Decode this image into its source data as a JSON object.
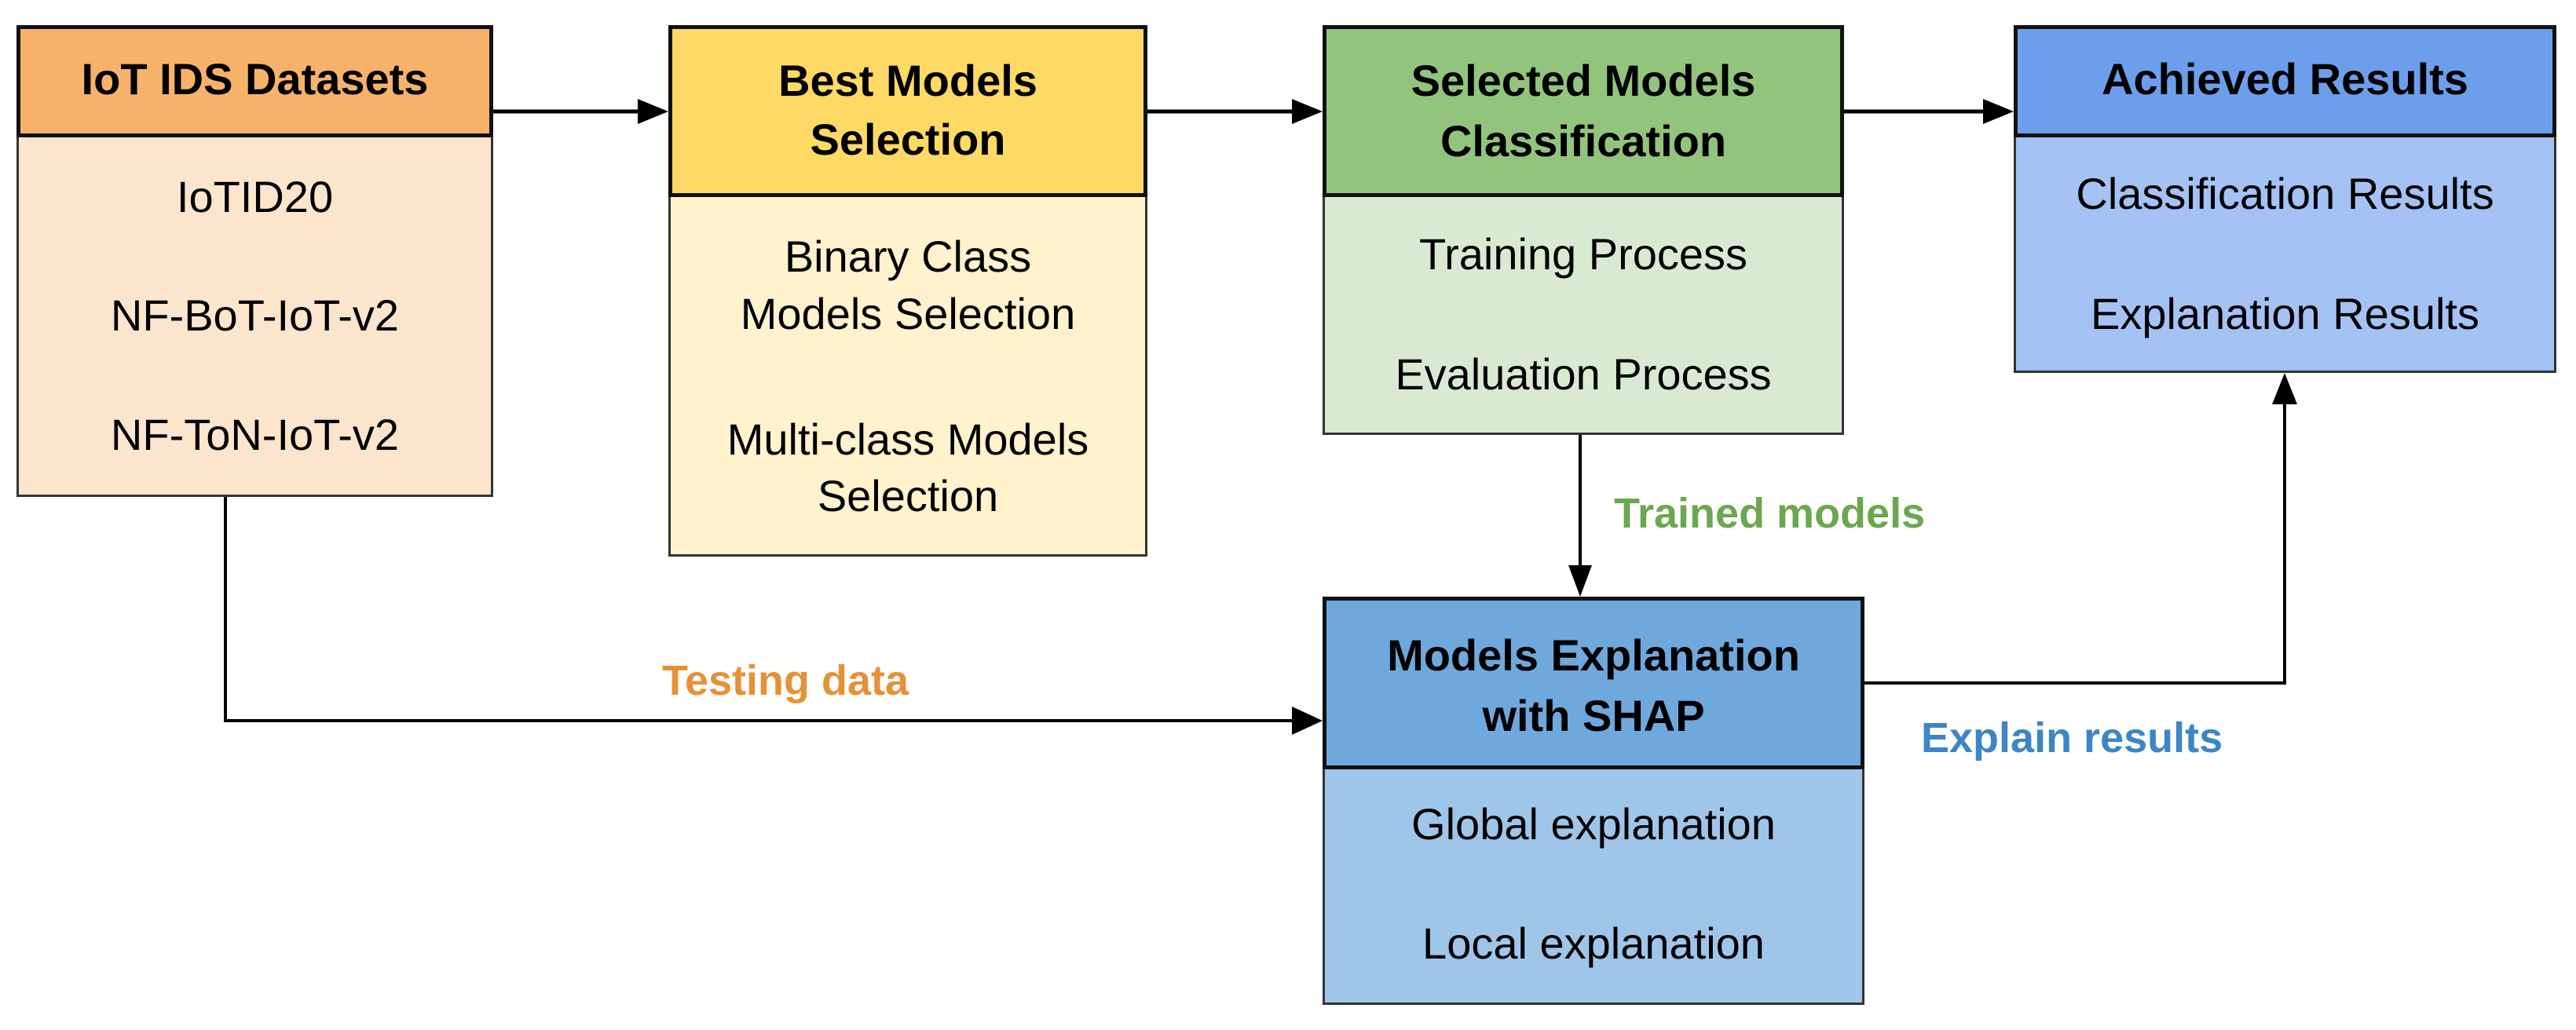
{
  "diagram": {
    "boxes": [
      {
        "name": "iot-ids-datasets",
        "title": [
          "IoT IDS Datasets"
        ],
        "items": [
          "IoTID20",
          "NF-BoT-IoT-v2",
          "NF-ToN-IoT-v2"
        ],
        "header_color": "#F6B26B",
        "body_color": "#FCE5CD"
      },
      {
        "name": "best-models-selection",
        "title": [
          "Best Models",
          "Selection"
        ],
        "items": [
          [
            "Binary Class",
            "Models Selection"
          ],
          [
            "Multi-class Models",
            "Selection"
          ]
        ],
        "header_color": "#FFD966",
        "body_color": "#FFF2CC"
      },
      {
        "name": "selected-models-classification",
        "title": [
          "Selected Models",
          "Classification"
        ],
        "items": [
          "Training Process",
          "Evaluation Process"
        ],
        "header_color": "#93C47D",
        "body_color": "#D9EAD3"
      },
      {
        "name": "achieved-results",
        "title": [
          "Achieved Results"
        ],
        "items": [
          "Classification Results",
          "Explanation Results"
        ],
        "header_color": "#6D9EEB",
        "body_color": "#A4C2F4"
      },
      {
        "name": "models-explanation-with-shap",
        "title": [
          "Models Explanation",
          "with SHAP"
        ],
        "items": [
          "Global explanation",
          "Local explanation"
        ],
        "header_color": "#6FA8DC",
        "body_color": "#9FC5E8"
      }
    ],
    "edges": [
      {
        "from": "IoT IDS Datasets",
        "to": "Best Models Selection",
        "label": ""
      },
      {
        "from": "Best Models Selection",
        "to": "Selected Models Classification",
        "label": ""
      },
      {
        "from": "Selected Models Classification",
        "to": "Achieved Results",
        "label": ""
      },
      {
        "from": "Selected Models Classification",
        "to": "Models Explanation with SHAP",
        "label": "Trained models",
        "label_color": "#6AA84F"
      },
      {
        "from": "IoT IDS Datasets",
        "to": "Models Explanation with SHAP",
        "label": "Testing data",
        "label_color": "#E69138"
      },
      {
        "from": "Models Explanation with SHAP",
        "to": "Achieved Results",
        "label": "Explain results",
        "label_color": "#3D85C6"
      }
    ]
  }
}
